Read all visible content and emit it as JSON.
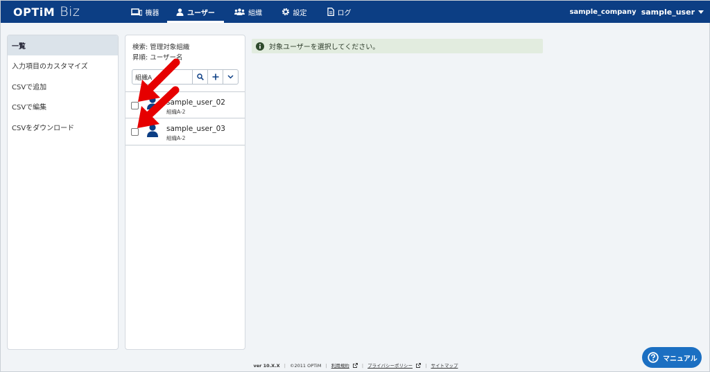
{
  "header": {
    "logo_main": "OPTiM",
    "logo_sub": "Biz",
    "nav": [
      {
        "label": "機器",
        "icon": "devices-icon"
      },
      {
        "label": "ユーザー",
        "icon": "user-icon",
        "active": true
      },
      {
        "label": "組織",
        "icon": "organization-icon"
      },
      {
        "label": "設定",
        "icon": "gear-icon"
      },
      {
        "label": "ログ",
        "icon": "log-icon"
      }
    ],
    "company": "sample_company",
    "user": "sample_user"
  },
  "sidebar": {
    "items": [
      {
        "label": "一覧",
        "active": true
      },
      {
        "label": "入力項目のカスタマイズ"
      },
      {
        "label": "CSVで追加"
      },
      {
        "label": "CSVで編集"
      },
      {
        "label": "CSVをダウンロード"
      }
    ]
  },
  "list": {
    "search_condition": "検索: 管理対象組織",
    "sort_order": "昇順: ユーザー名",
    "search_value": "組織A",
    "users": [
      {
        "name": "sample_user_02",
        "org": "組織A-2",
        "checked": false
      },
      {
        "name": "sample_user_03",
        "org": "組織A-2",
        "checked": false
      }
    ]
  },
  "notice": {
    "text": "対象ユーザーを選択してください。"
  },
  "footer": {
    "version": "ver 10.X.X",
    "copyright": "©2011 OPTiM",
    "terms": "利用規約",
    "privacy": "プライバシーポリシー",
    "sitemap": "サイトマップ"
  },
  "manual_button": {
    "label": "マニュアル"
  },
  "colors": {
    "header_bg": "#0c3e84",
    "accent": "#1b6fc2",
    "annotation_arrow": "#e60000"
  }
}
